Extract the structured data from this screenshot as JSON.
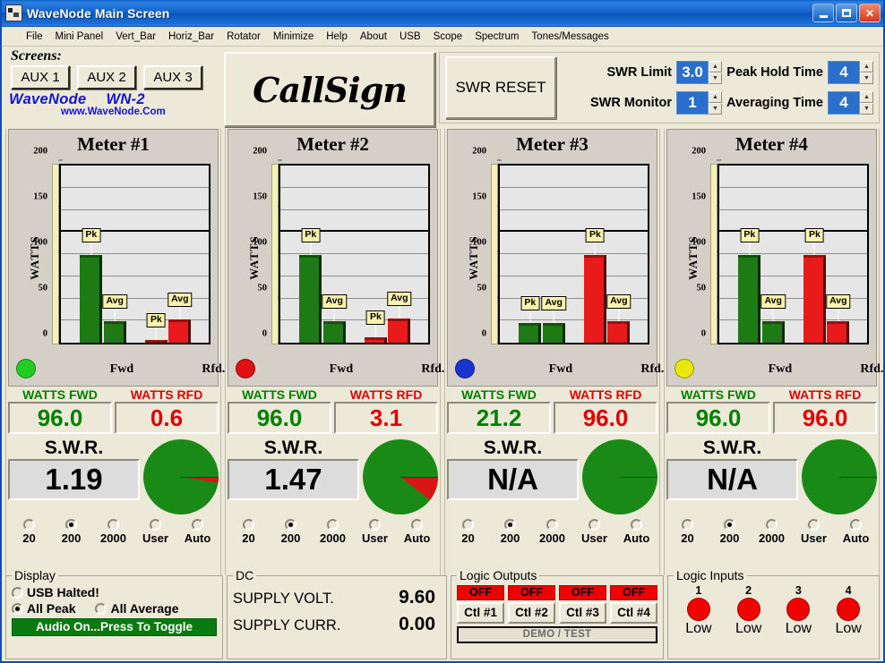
{
  "window": {
    "title": "WaveNode Main Screen",
    "icon": "app-icon",
    "buttons": {
      "minimize": "–",
      "maximize": "□",
      "close": "✕"
    }
  },
  "menubar": {
    "items": [
      {
        "label": "File"
      },
      {
        "label": "Mini Panel"
      },
      {
        "label": "Vert_Bar"
      },
      {
        "label": "Horiz_Bar"
      },
      {
        "label": "Rotator"
      },
      {
        "label": "Minimize"
      },
      {
        "label": "Help"
      },
      {
        "label": "About"
      },
      {
        "label": "USB"
      },
      {
        "label": "Scope"
      },
      {
        "label": "Spectrum"
      },
      {
        "label": "Tones/Messages"
      }
    ]
  },
  "screens": {
    "label": "Screens:",
    "buttons": [
      {
        "label": "AUX 1"
      },
      {
        "label": "AUX 2"
      },
      {
        "label": "AUX 3"
      }
    ]
  },
  "brand": {
    "name": "WaveNode",
    "model": "WN-2",
    "url": "www.WaveNode.Com",
    "color": "#1414d2"
  },
  "callsign": {
    "text": "CallSign"
  },
  "swr_panel": {
    "reset_label": "SWR RESET",
    "fields": [
      {
        "label": "SWR Limit",
        "value": "3.0"
      },
      {
        "label": "Peak Hold Time",
        "value": "4"
      },
      {
        "label": "SWR Monitor",
        "value": "1"
      },
      {
        "label": "Averaging Time",
        "value": "4"
      }
    ],
    "spin_up": "▲",
    "spin_down": "▼"
  },
  "meter_common": {
    "readout_fwd_header": "WATTS FWD",
    "readout_rfd_header": "WATTS RFD",
    "swr_caption": "S.W.R.",
    "x_labels": [
      "Fwd",
      "Rfd."
    ],
    "y_label": "WATTS",
    "y_ticks": [
      "200",
      "150",
      "100",
      "50",
      "0"
    ],
    "range_options": [
      "20",
      "200",
      "2000",
      "User",
      "Auto"
    ],
    "selected_range": "200",
    "pk_label": "Pk",
    "avg_label": "Avg"
  },
  "meters": [
    {
      "title": "Meter #1",
      "led_color": "#22cc22",
      "watts_fwd": "96.0",
      "watts_rfd": "0.6",
      "swr": "1.19",
      "swr_wedge_deg": 9,
      "chart_data": {
        "type": "bar",
        "title": "Meter #1",
        "ylabel": "WATTS",
        "ylim": [
          0,
          200
        ],
        "yticks": [
          0,
          50,
          100,
          150,
          200
        ],
        "grid": true,
        "categories": [
          "Fwd",
          "Rfd."
        ],
        "series": [
          {
            "name": "Pk",
            "values": [
              96.0,
              1.8
            ],
            "colors": [
              "#1e7a14",
              "#e81a1a"
            ]
          },
          {
            "name": "Avg",
            "values": [
              24.0,
              25.5
            ],
            "colors": [
              "#1e7a14",
              "#e81a1a"
            ]
          }
        ]
      }
    },
    {
      "title": "Meter #2",
      "led_color": "#e01010",
      "watts_fwd": "96.0",
      "watts_rfd": "3.1",
      "swr": "1.47",
      "swr_wedge_deg": 38,
      "chart_data": {
        "type": "bar",
        "title": "Meter #2",
        "ylabel": "WATTS",
        "ylim": [
          0,
          200
        ],
        "yticks": [
          0,
          50,
          100,
          150,
          200
        ],
        "grid": true,
        "categories": [
          "Fwd",
          "Rfd."
        ],
        "series": [
          {
            "name": "Pk",
            "values": [
              96.0,
              5.5
            ],
            "colors": [
              "#1e7a14",
              "#e81a1a"
            ]
          },
          {
            "name": "Avg",
            "values": [
              24.0,
              26.0
            ],
            "colors": [
              "#1e7a14",
              "#e81a1a"
            ]
          }
        ]
      }
    },
    {
      "title": "Meter #3",
      "led_color": "#1a34d0",
      "watts_fwd": "21.2",
      "watts_rfd": "96.0",
      "swr": "N/A",
      "swr_wedge_deg": 0,
      "chart_data": {
        "type": "bar",
        "title": "Meter #3",
        "ylabel": "WATTS",
        "ylim": [
          0,
          200
        ],
        "yticks": [
          0,
          50,
          100,
          150,
          200
        ],
        "grid": true,
        "categories": [
          "Fwd",
          "Rfd."
        ],
        "series": [
          {
            "name": "Pk",
            "values": [
              21.2,
              96.0
            ],
            "colors": [
              "#1e7a14",
              "#e81a1a"
            ]
          },
          {
            "name": "Avg",
            "values": [
              21.2,
              24.0
            ],
            "colors": [
              "#1e7a14",
              "#e81a1a"
            ]
          }
        ]
      }
    },
    {
      "title": "Meter #4",
      "led_color": "#e8e80c",
      "watts_fwd": "96.0",
      "watts_rfd": "96.0",
      "swr": "N/A",
      "swr_wedge_deg": 0,
      "chart_data": {
        "type": "bar",
        "title": "Meter #4",
        "ylabel": "WATTS",
        "ylim": [
          0,
          200
        ],
        "yticks": [
          0,
          50,
          100,
          150,
          200
        ],
        "grid": true,
        "categories": [
          "Fwd",
          "Rfd."
        ],
        "series": [
          {
            "name": "Pk",
            "values": [
              96.0,
              96.0
            ],
            "colors": [
              "#1e7a14",
              "#e81a1a"
            ]
          },
          {
            "name": "Avg",
            "values": [
              24.0,
              24.0
            ],
            "colors": [
              "#1e7a14",
              "#e81a1a"
            ]
          }
        ]
      }
    }
  ],
  "display_group": {
    "legend": "Display",
    "usb_label": "USB Halted!",
    "usb_checked": false,
    "all_peak_label": "All Peak",
    "all_peak_checked": true,
    "all_average_label": "All Average",
    "all_average_checked": false,
    "audio_button": "Audio On...Press To Toggle",
    "audio_color": "#087a10"
  },
  "dc_group": {
    "legend": "DC",
    "rows": [
      {
        "label": "SUPPLY VOLT.",
        "value": "9.60"
      },
      {
        "label": "SUPPLY CURR.",
        "value": "0.00"
      }
    ]
  },
  "logic_outputs": {
    "legend": "Logic Outputs",
    "controls": [
      {
        "state": "OFF",
        "label": "Ctl #1"
      },
      {
        "state": "OFF",
        "label": "Ctl #2"
      },
      {
        "state": "OFF",
        "label": "Ctl #3"
      },
      {
        "state": "OFF",
        "label": "Ctl #4"
      }
    ],
    "demo_label": "DEMO / TEST",
    "off_color": "#f00000"
  },
  "logic_inputs": {
    "legend": "Logic Inputs",
    "inputs": [
      {
        "num": "1",
        "state": "Low"
      },
      {
        "num": "2",
        "state": "Low"
      },
      {
        "num": "3",
        "state": "Low"
      },
      {
        "num": "4",
        "state": "Low"
      }
    ],
    "led_color": "#f00000"
  }
}
